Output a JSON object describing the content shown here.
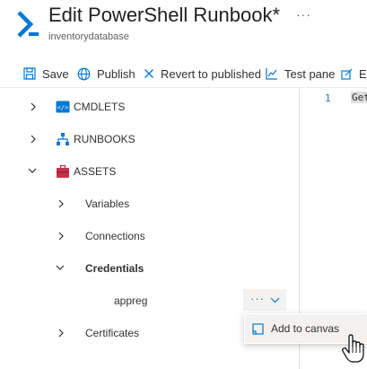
{
  "header": {
    "title": "Edit PowerShell Runbook*",
    "subtitle": "inventorydatabase",
    "more_label": "···"
  },
  "toolbar": {
    "save_label": "Save",
    "publish_label": "Publish",
    "revert_label": "Revert to published",
    "test_pane_label": "Test pane",
    "truncated_label": "E"
  },
  "tree": {
    "cmdlets": "CMDLETS",
    "runbooks": "RUNBOOKS",
    "assets": "ASSETS",
    "variables": "Variables",
    "connections": "Connections",
    "credentials": "Credentials",
    "credential_item": "appreg",
    "certificates": "Certificates"
  },
  "item_actions": {
    "ellipsis": "···"
  },
  "context_menu": {
    "add_to_canvas": "Add to canvas"
  },
  "editor": {
    "line_number": "1",
    "code": "Get"
  },
  "colors": {
    "accent": "#0078d4",
    "assets_icon": "#c4314b",
    "selection": "#f3f2f1"
  }
}
